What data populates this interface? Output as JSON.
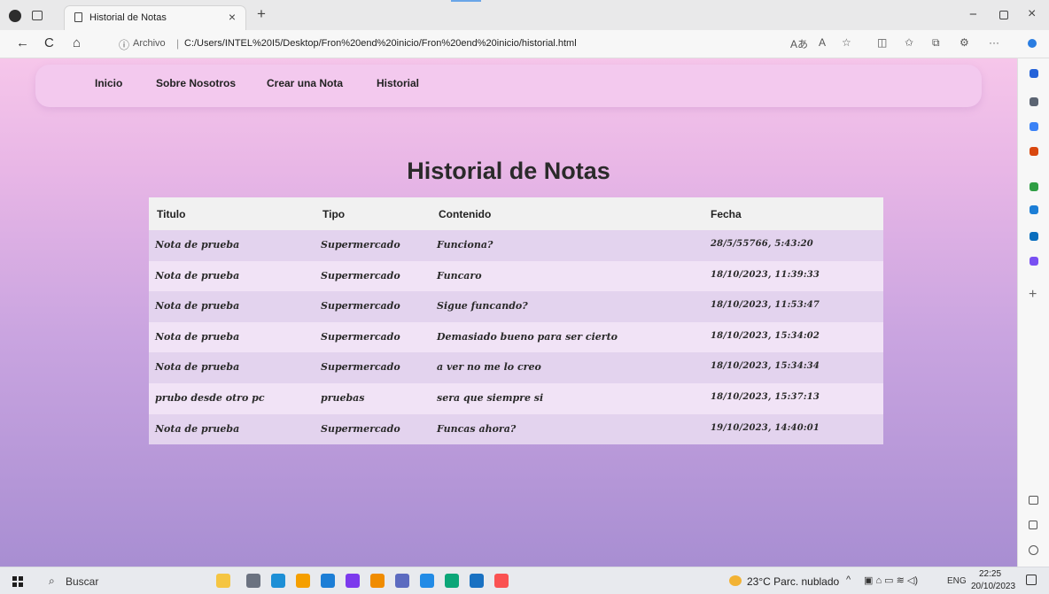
{
  "browser": {
    "tab_title": "Historial de Notas",
    "tab_close": "×",
    "new_tab": "+",
    "window_min": "−",
    "window_close": "×",
    "back": "←",
    "refresh": "C",
    "home": "⌂",
    "url_info_glyph": "ⓘ",
    "url_scheme_label": "Archivo",
    "url_separator": "|",
    "url": "C:/Users/INTEL%20I5/Desktop/Fron%20end%20inicio/Fron%20end%20inicio/historial.html",
    "read_aloud": "Aあ",
    "text_size": "A",
    "favorite": "☆",
    "split": "◫",
    "favorites_bar": "✩",
    "collections": "⧉",
    "extensions": "⚙",
    "more": "···"
  },
  "nav": {
    "links": [
      "Inicio",
      "Sobre Nosotros",
      "Crear una Nota",
      "Historial"
    ]
  },
  "page": {
    "title": "Historial de Notas"
  },
  "table": {
    "headers": [
      "Titulo",
      "Tipo",
      "Contenido",
      "Fecha"
    ],
    "rows": [
      [
        "Nota de prueba",
        "Supermercado",
        "Funciona?",
        "28/5/55766, 5:43:20"
      ],
      [
        "Nota de prueba",
        "Supermercado",
        "Funcaro",
        "18/10/2023, 11:39:33"
      ],
      [
        "Nota de prueba",
        "Supermercado",
        "Sigue funcando?",
        "18/10/2023, 11:53:47"
      ],
      [
        "Nota de prueba",
        "Supermercado",
        "Demasiado bueno para ser cierto",
        "18/10/2023, 15:34:02"
      ],
      [
        "Nota de prueba",
        "Supermercado",
        "a ver no me lo creo",
        "18/10/2023, 15:34:34"
      ],
      [
        "prubo desde otro pc",
        "pruebas",
        "sera que siempre si",
        "18/10/2023, 15:37:13"
      ],
      [
        "Nota de prueba",
        "Supermercado",
        "Funcas ahora?",
        "19/10/2023, 14:40:01"
      ]
    ]
  },
  "sidebar": {
    "add": "+",
    "icon_colors": [
      "#2563d9",
      "#5b6472",
      "#3b82f6",
      "#d9480f",
      "#2f9e44",
      "#1c7ed6",
      "#0a6ebd",
      "#7950f2"
    ]
  },
  "taskbar": {
    "search_glyph": "⌕",
    "search_label": "Buscar",
    "app_colors": [
      "#f5c542",
      "#6b7280",
      "#1d8fd6",
      "#f59f00",
      "#1c7ed6",
      "#7c3aed",
      "#f08c00",
      "#5c6bc0",
      "#228be6",
      "#0ca678",
      "#1971c2",
      "#fa5252"
    ],
    "weather": "23°C  Parc. nublado",
    "tray_up": "^",
    "tray_icons": "▣ ⌂ ▭ ≋ ◁)",
    "lang": "ENG",
    "time": "22:25",
    "date": "20/10/2023"
  }
}
